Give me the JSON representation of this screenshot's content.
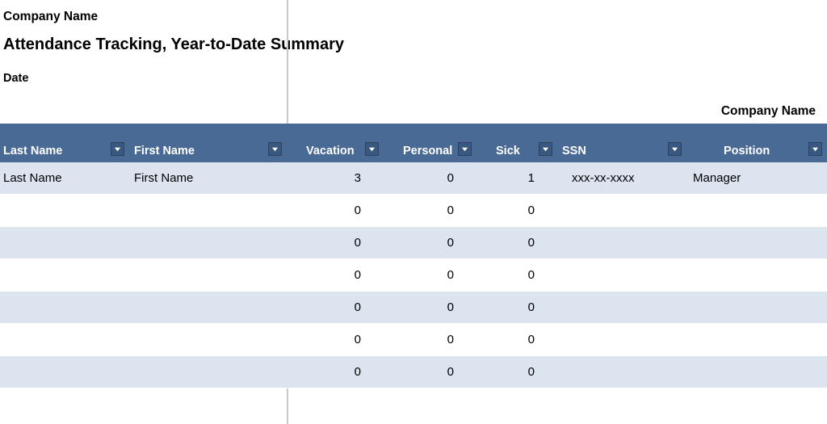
{
  "header": {
    "company_name_top": "Company Name",
    "title": "Attendance Tracking, Year-to-Date Summary",
    "date_label": "Date",
    "company_name_right": "Company Name"
  },
  "columns": {
    "last_name": "Last Name",
    "first_name": "First Name",
    "vacation": "Vacation",
    "personal": "Personal",
    "sick": "Sick",
    "ssn": "SSN",
    "position": "Position"
  },
  "rows": [
    {
      "last_name": "Last Name",
      "first_name": "First Name",
      "vacation": "3",
      "personal": "0",
      "sick": "1",
      "ssn": "xxx-xx-xxxx",
      "position": "Manager"
    },
    {
      "last_name": "",
      "first_name": "",
      "vacation": "0",
      "personal": "0",
      "sick": "0",
      "ssn": "",
      "position": ""
    },
    {
      "last_name": "",
      "first_name": "",
      "vacation": "0",
      "personal": "0",
      "sick": "0",
      "ssn": "",
      "position": ""
    },
    {
      "last_name": "",
      "first_name": "",
      "vacation": "0",
      "personal": "0",
      "sick": "0",
      "ssn": "",
      "position": ""
    },
    {
      "last_name": "",
      "first_name": "",
      "vacation": "0",
      "personal": "0",
      "sick": "0",
      "ssn": "",
      "position": ""
    },
    {
      "last_name": "",
      "first_name": "",
      "vacation": "0",
      "personal": "0",
      "sick": "0",
      "ssn": "",
      "position": ""
    },
    {
      "last_name": "",
      "first_name": "",
      "vacation": "0",
      "personal": "0",
      "sick": "0",
      "ssn": "",
      "position": ""
    }
  ],
  "colors": {
    "header_bg": "#4a6a96",
    "band_a": "#dbe4ef",
    "band_b": "#ffffff",
    "grey_cols": "#d5d5d0"
  }
}
